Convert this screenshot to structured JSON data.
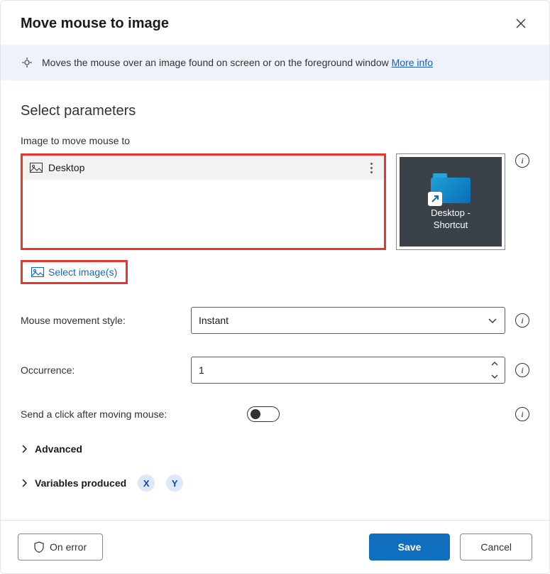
{
  "title": "Move mouse to image",
  "banner": {
    "text": "Moves the mouse over an image found on screen or on the foreground window ",
    "link": "More info"
  },
  "section_title": "Select parameters",
  "image_field_label": "Image to move mouse to",
  "image_list": {
    "items": [
      {
        "name": "Desktop"
      }
    ]
  },
  "preview": {
    "line1": "Desktop -",
    "line2": "Shortcut"
  },
  "select_images_label": "Select image(s)",
  "rows": {
    "movement": {
      "label": "Mouse movement style:",
      "value": "Instant"
    },
    "occurrence": {
      "label": "Occurrence:",
      "value": "1"
    },
    "send_click": {
      "label": "Send a click after moving mouse:"
    }
  },
  "expanders": {
    "advanced": "Advanced",
    "variables": "Variables produced",
    "vars": [
      "X",
      "Y"
    ]
  },
  "footer": {
    "on_error": "On error",
    "save": "Save",
    "cancel": "Cancel"
  }
}
